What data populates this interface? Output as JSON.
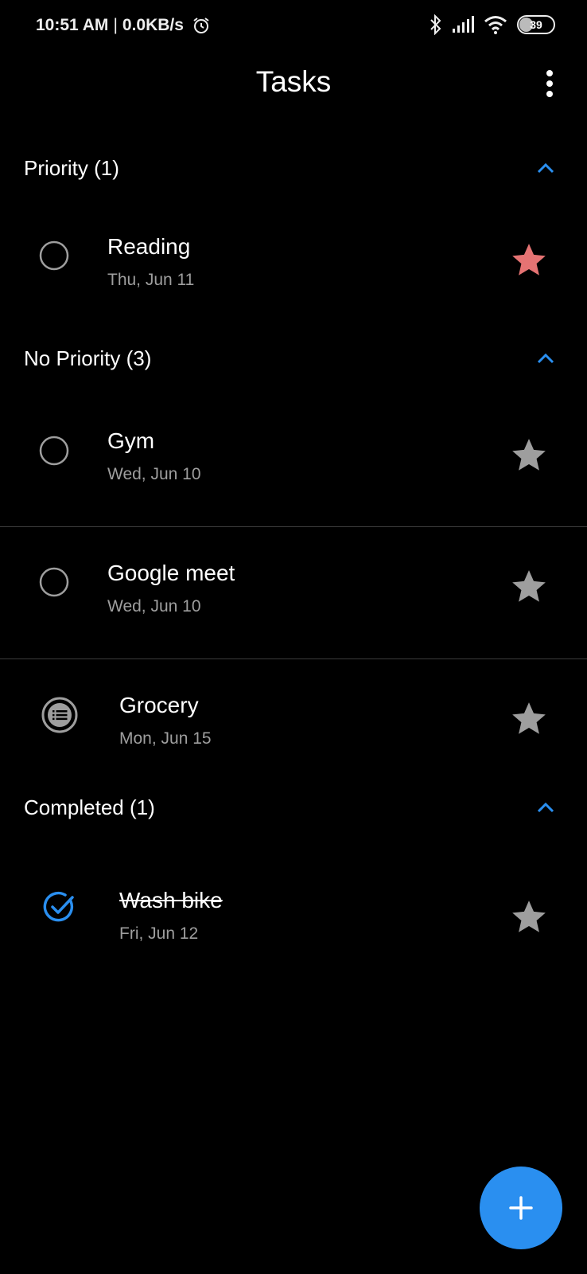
{
  "status_bar": {
    "time": "10:51 AM",
    "separator": "|",
    "network_speed": "0.0KB/s",
    "battery_level": "39",
    "icons": [
      "alarm-icon",
      "bluetooth-icon",
      "signal-icon",
      "wifi-icon",
      "battery-icon"
    ]
  },
  "app_bar": {
    "title": "Tasks",
    "menu_icon": "more-vert-icon"
  },
  "sections": [
    {
      "title": "Priority (1)",
      "tasks": [
        {
          "title": "Reading",
          "date": "Thu, Jun 11",
          "state": "open",
          "starred": true
        }
      ]
    },
    {
      "title": "No Priority (3)",
      "tasks": [
        {
          "title": "Gym",
          "date": "Wed, Jun 10",
          "state": "open",
          "starred": false
        },
        {
          "title": "Google meet",
          "date": "Wed, Jun 10",
          "state": "open",
          "starred": false
        },
        {
          "title": "Grocery",
          "date": "Mon, Jun 15",
          "state": "list",
          "starred": false
        }
      ]
    },
    {
      "title": "Completed (1)",
      "tasks": [
        {
          "title": "Wash bike",
          "date": "Fri, Jun 12",
          "state": "done",
          "starred": false
        }
      ]
    }
  ],
  "colors": {
    "accent": "#2a8ff0",
    "star_active": "#e57373",
    "star_inactive": "#9e9e9e",
    "secondary_text": "#9e9e9e"
  },
  "fab": {
    "icon": "plus-icon"
  }
}
